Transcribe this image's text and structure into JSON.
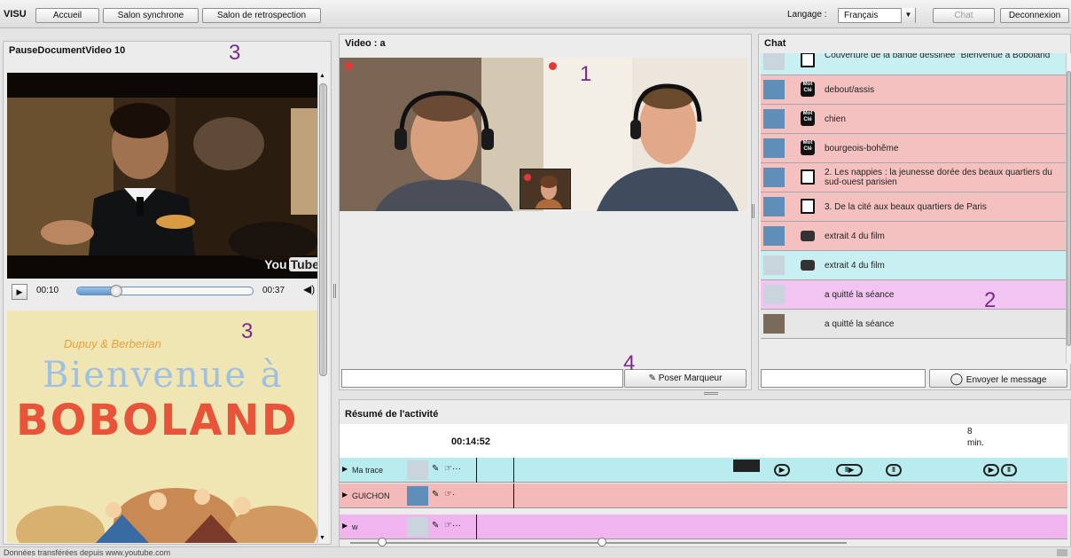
{
  "topbar": {
    "app_name": "VISU",
    "nav": [
      "Accueil",
      "Salon synchrone",
      "Salon de retrospection"
    ],
    "language_label": "Langage :",
    "language_value": "Français",
    "chat_button": "Chat",
    "logout_button": "Deconnexion"
  },
  "left_panel": {
    "title": "PauseDocumentVideo 10",
    "video_brand": "YouTube",
    "time_current": "00:10",
    "time_total": "00:37",
    "playback_progress": 0.22,
    "book_author": "Dupuy & Berberian",
    "book_title_line1": "Bienvenue à",
    "book_title_line2": "BOBOLAND"
  },
  "video_panel": {
    "title": "Video : a",
    "marker_input_placeholder": "",
    "marker_button": "Poser Marqueur"
  },
  "chat_panel": {
    "title": "Chat",
    "messages": [
      {
        "text": "Couverture de la bande dessinée \"Bienvenue à Boboland\"",
        "color": "#c8f0f2",
        "icon": "document-icon"
      },
      {
        "text": "debout/assis",
        "color": "#f5c0c0",
        "icon": "motcle-icon"
      },
      {
        "text": "chien",
        "color": "#f5c0c0",
        "icon": "motcle-icon"
      },
      {
        "text": "bourgeois-bohême",
        "color": "#f5c0c0",
        "icon": "motcle-icon"
      },
      {
        "text": "2. Les nappies : la jeunesse dorée des beaux quartiers du sud-ouest parisien",
        "color": "#f5c0c0",
        "icon": "document-icon"
      },
      {
        "text": "3. De la cité aux beaux quartiers de Paris",
        "color": "#f5c0c0",
        "icon": "document-icon"
      },
      {
        "text": "extrait 4 du film",
        "color": "#f5c0c0",
        "icon": "film-icon"
      },
      {
        "text": "extrait 4 du film",
        "color": "#c8f0f2",
        "icon": "film-icon"
      },
      {
        "text": "a quitté la séance",
        "color": "#f2c4f2",
        "icon": ""
      },
      {
        "text": "a quitté la séance",
        "color": "#e6e6e6",
        "icon": ""
      }
    ],
    "motcle_label": "Mot Clé",
    "input_placeholder": "",
    "send_button": "Envoyer le message"
  },
  "activity": {
    "title": "Résumé de l'activité",
    "time": "00:14:52",
    "duration_value": "8",
    "duration_unit": "min.",
    "rows": [
      {
        "name": "Ma trace",
        "color": "#b9ecef"
      },
      {
        "name": "GUICHON",
        "color": "#f4b9b9"
      },
      {
        "name": "w",
        "color": "#f0b4ef"
      }
    ]
  },
  "status_bar": {
    "text": "Données transférées depuis www.youtube.com"
  },
  "annotations": {
    "n1": "1",
    "n2": "2",
    "n3a": "3",
    "n3b": "3",
    "n4": "4"
  }
}
